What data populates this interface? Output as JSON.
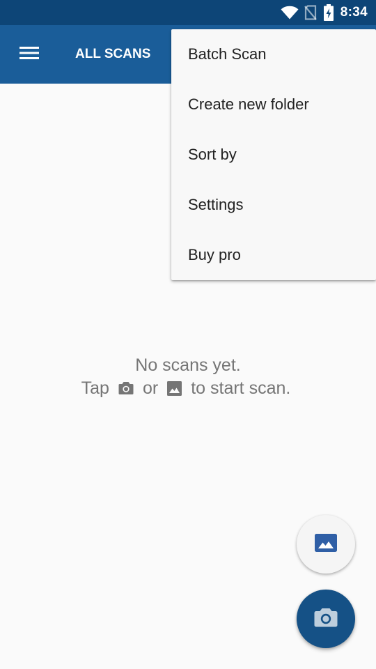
{
  "status_bar": {
    "time": "8:34",
    "icons": [
      "wifi-icon",
      "no-sim-icon",
      "battery-charging-icon"
    ]
  },
  "app_bar": {
    "title": "ALL SCANS",
    "menu_icon": "menu-icon"
  },
  "overflow_menu": {
    "items": [
      {
        "label": "Batch Scan"
      },
      {
        "label": "Create new folder"
      },
      {
        "label": "Sort by"
      },
      {
        "label": "Settings"
      },
      {
        "label": "Buy pro"
      }
    ]
  },
  "empty_state": {
    "line1": "No scans yet.",
    "tap": "Tap",
    "or": "or",
    "suffix": "to start scan.",
    "icons": [
      "camera-icon",
      "image-icon"
    ]
  },
  "fabs": {
    "gallery_icon": "image-icon",
    "camera_icon": "camera-icon"
  },
  "colors": {
    "status_bar": "#0d4577",
    "app_bar": "#1a5d99",
    "fab_camera": "#155186",
    "gallery_icon": "#2f5fa6",
    "background": "#fafafa",
    "empty_text": "#757575"
  }
}
